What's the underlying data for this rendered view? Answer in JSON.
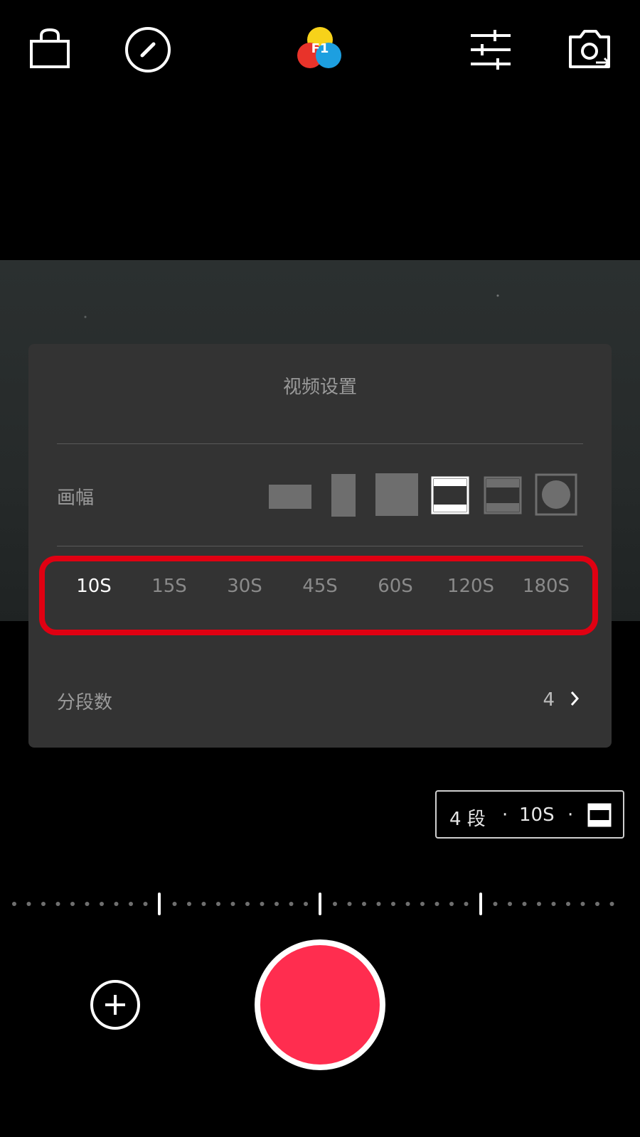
{
  "topbar": {
    "icons": [
      "shopping-bag-icon",
      "speed-dial-icon",
      "filter-logo-icon",
      "sliders-icon",
      "switch-camera-icon"
    ],
    "filter_label": "F1",
    "filter_colors": [
      "#f7d21a",
      "#e8332a",
      "#1d9fe0"
    ]
  },
  "panel": {
    "title": "视频设置",
    "aspect_label": "画幅",
    "aspect_options": [
      "landscape",
      "portrait",
      "square",
      "letterbox-selected",
      "letterbox",
      "circle"
    ],
    "aspect_selected_index": 3,
    "durations": [
      "10S",
      "15S",
      "30S",
      "45S",
      "60S",
      "120S",
      "180S"
    ],
    "duration_selected": "10S",
    "highlight_color": "#e00012",
    "segments_label": "分段数",
    "segments_value": "4"
  },
  "summary": {
    "segments": "4 段",
    "sep1": "·",
    "duration": "10S",
    "sep2": "·"
  },
  "timeline": {
    "markers": 3
  },
  "controls": {
    "record_color": "#ff2d4f"
  }
}
